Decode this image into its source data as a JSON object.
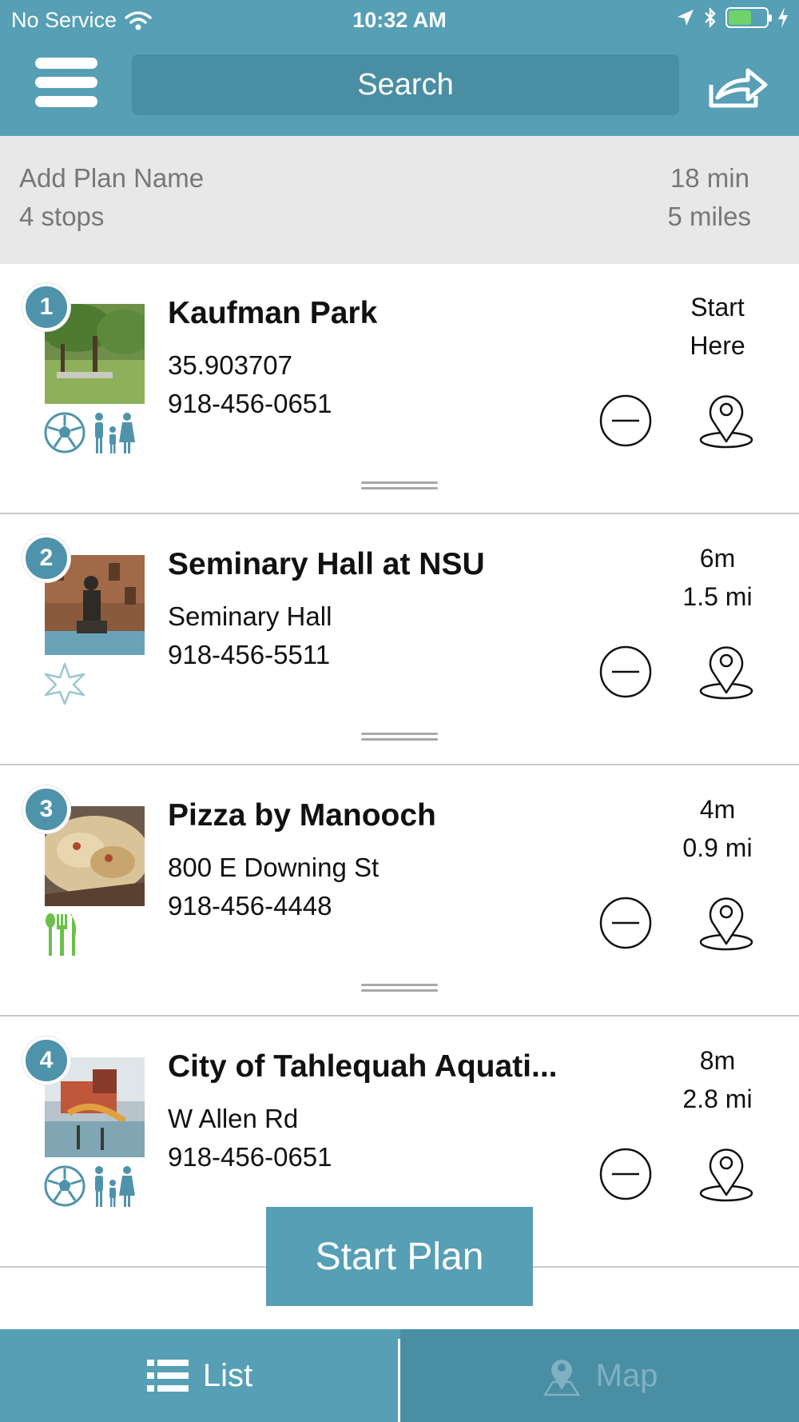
{
  "status_bar": {
    "carrier": "No Service",
    "time": "10:32 AM"
  },
  "header": {
    "menu_icon": "hamburger-menu-icon",
    "search_placeholder": "Search",
    "share_icon": "share-arrow-icon",
    "accent_color": "#569fb5"
  },
  "plan": {
    "name_placeholder": "Add Plan Name",
    "stops_count": "4 stops",
    "duration": "18 min",
    "distance": "5 miles"
  },
  "stops": [
    {
      "number": "1",
      "name": "Kaufman Park",
      "line1": "35.903707",
      "line2": "918-456-0651",
      "dist_top": "Start",
      "dist_bottom": "Here",
      "categories": [
        "soccer-ball-icon",
        "family-icon"
      ]
    },
    {
      "number": "2",
      "name": "Seminary Hall at NSU",
      "line1": "Seminary Hall",
      "line2": "918-456-5511",
      "dist_top": "6m",
      "dist_bottom": "1.5 mi",
      "categories": [
        "star-landmark-icon"
      ]
    },
    {
      "number": "3",
      "name": "Pizza by Manooch",
      "line1": "800 E Downing St",
      "line2": "918-456-4448",
      "dist_top": "4m",
      "dist_bottom": "0.9 mi",
      "categories": [
        "fork-knife-icon"
      ]
    },
    {
      "number": "4",
      "name": "City of Tahlequah Aquati...",
      "line1": "W Allen Rd",
      "line2": "918-456-0651",
      "dist_top": "8m",
      "dist_bottom": "2.8 mi",
      "categories": [
        "soccer-ball-icon",
        "family-icon"
      ]
    }
  ],
  "actions": {
    "start_plan": "Start Plan"
  },
  "tabs": {
    "list": "List",
    "map": "Map",
    "active": "List"
  }
}
